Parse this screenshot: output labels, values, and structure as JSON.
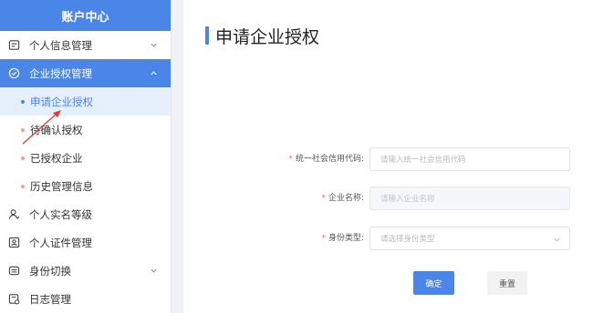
{
  "sidebar": {
    "title": "账户中心",
    "items": [
      {
        "label": "个人信息管理"
      },
      {
        "label": "企业授权管理"
      },
      {
        "label": "个人实名等级"
      },
      {
        "label": "个人证件管理"
      },
      {
        "label": "身份切换"
      },
      {
        "label": "日志管理"
      }
    ],
    "sub_items": [
      {
        "label": "申请企业授权"
      },
      {
        "label": "待确认授权"
      },
      {
        "label": "已授权企业"
      },
      {
        "label": "历史管理信息"
      }
    ]
  },
  "main": {
    "title": "申请企业授权",
    "form": {
      "credit_code_label": "统一社会信用代码:",
      "credit_code_placeholder": "请输入统一社会信用代码",
      "company_name_label": "企业名称:",
      "company_name_placeholder": "请输入企业名称",
      "identity_type_label": "身份类型:",
      "identity_type_placeholder": "请选择身份类型",
      "required_mark": "*"
    },
    "buttons": {
      "confirm": "确定",
      "reset": "重置"
    }
  },
  "colors": {
    "accent": "#4a86e8",
    "active_bg": "#4a86e8",
    "selected_bg": "#e6f0fc",
    "required": "#f56c6c",
    "arrow": "#e53935"
  }
}
